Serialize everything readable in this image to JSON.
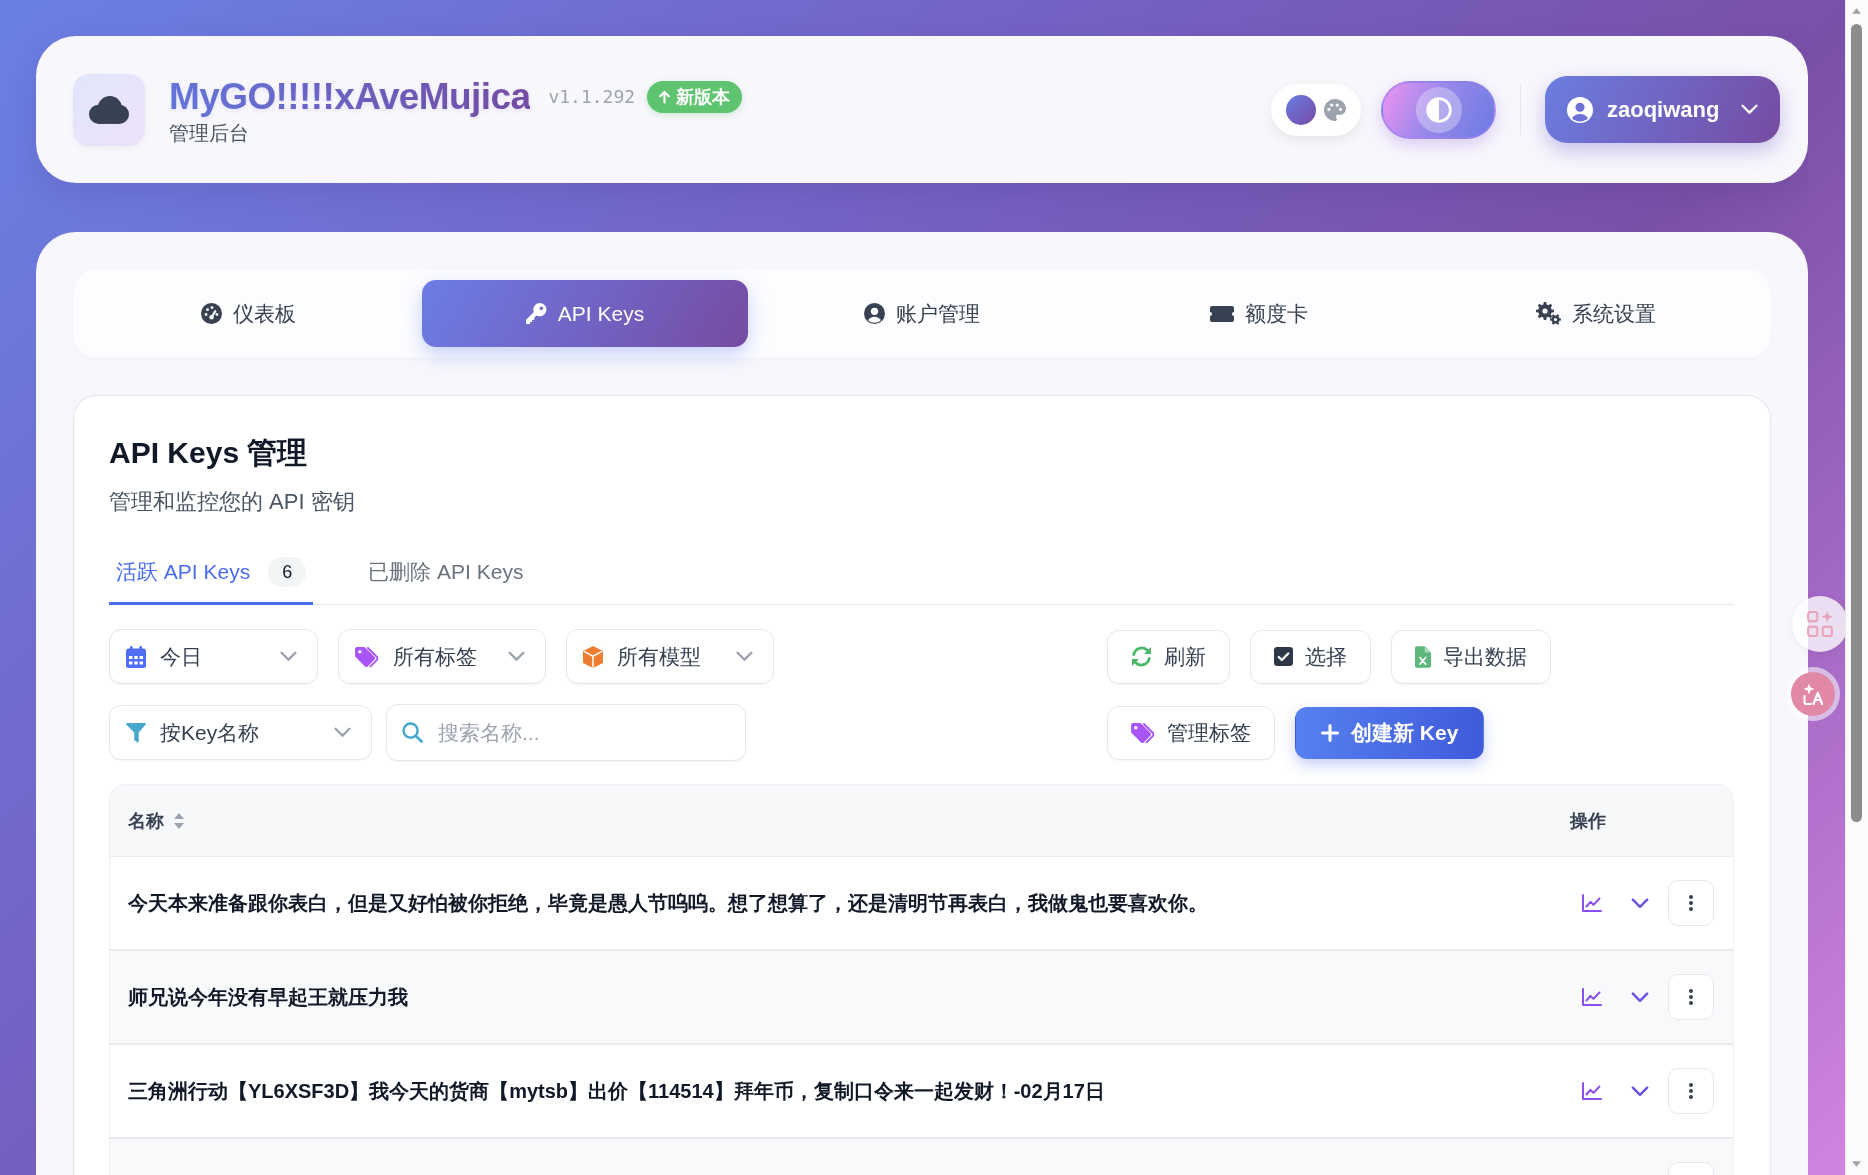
{
  "header": {
    "logo_title": "MyGO!!!!!xAveMujica",
    "version": "v1.1.292",
    "update_badge": "新版本",
    "subtitle": "管理后台",
    "theme_toggle": {
      "on": true
    },
    "user_name": "zaoqiwang"
  },
  "nav_tabs": [
    {
      "label": "仪表板",
      "selected": false
    },
    {
      "label": "API Keys",
      "selected": true
    },
    {
      "label": "账户管理",
      "selected": false
    },
    {
      "label": "额度卡",
      "selected": false
    },
    {
      "label": "系统设置",
      "selected": false
    }
  ],
  "panel": {
    "title": "API Keys 管理",
    "subtitle": "管理和监控您的 API 密钥",
    "tabs": [
      {
        "label": "活跃 API Keys",
        "count": "6",
        "selected": true
      },
      {
        "label": "已删除 API Keys",
        "selected": false
      }
    ],
    "toolbar_rows": [
      {
        "filters": [
          {
            "value": "今日"
          },
          {
            "value": "所有标签"
          },
          {
            "value": "所有模型"
          }
        ],
        "buttons": [
          {
            "label": "刷新",
            "kind": "default"
          },
          {
            "label": "选择",
            "kind": "default"
          },
          {
            "label": "导出数据",
            "kind": "default"
          }
        ]
      },
      {
        "filters": [
          {
            "value": "按Key名称"
          }
        ],
        "search": {
          "placeholder": "搜索名称..."
        },
        "buttons": [
          {
            "label": "管理标签",
            "kind": "default"
          },
          {
            "label": "创建新 Key",
            "kind": "primary"
          }
        ]
      }
    ],
    "table": {
      "columns": [
        "名称",
        "操作"
      ],
      "rows": [
        {
          "name": "今天本来准备跟你表白，但是又好怕被你拒绝，毕竟是愚人节呜呜。想了想算了，还是清明节再表白，我做鬼也要喜欢你。"
        },
        {
          "name": "师兄说今年没有早起王就压力我"
        },
        {
          "name": "三角洲行动【YL6XSF3D】我今天的货商【mytsb】出价【114514】拜年币，复制口令来一起发财！-02月17日"
        },
        {}
      ]
    }
  }
}
